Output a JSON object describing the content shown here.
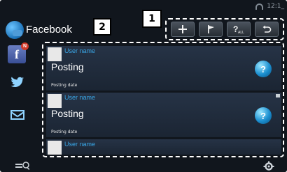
{
  "status": {
    "time": "12:1_"
  },
  "header": {
    "title": "Facebook",
    "small_label": ""
  },
  "callouts": {
    "one": "1",
    "two": "2"
  },
  "toolbar": {
    "buttons": [
      {
        "icon": "plus-icon",
        "glyph": "+"
      },
      {
        "icon": "flag-icon",
        "glyph": "⚑"
      },
      {
        "icon": "like-all-icon",
        "glyph": "?ALL"
      },
      {
        "icon": "back-icon",
        "glyph": "↺"
      }
    ]
  },
  "nav": {
    "facebook": {
      "glyph": "f",
      "badge": "N"
    },
    "twitter": {
      "glyph": "🐦"
    },
    "mail": {
      "glyph": "✉"
    }
  },
  "feed": {
    "posts": [
      {
        "user": "User name",
        "text": "Posting",
        "date": "Posting date"
      },
      {
        "user": "User name",
        "text": "Posting",
        "date": "Posting date"
      },
      {
        "user": "User name",
        "text": "",
        "date": ""
      }
    ],
    "like_glyph": "?"
  },
  "bottom": {
    "search_icon": "search-list-icon",
    "settings_icon": "gear-icon"
  },
  "colors": {
    "background": "#11161d",
    "accent": "#39a6e6",
    "post_bg": "#263346"
  }
}
